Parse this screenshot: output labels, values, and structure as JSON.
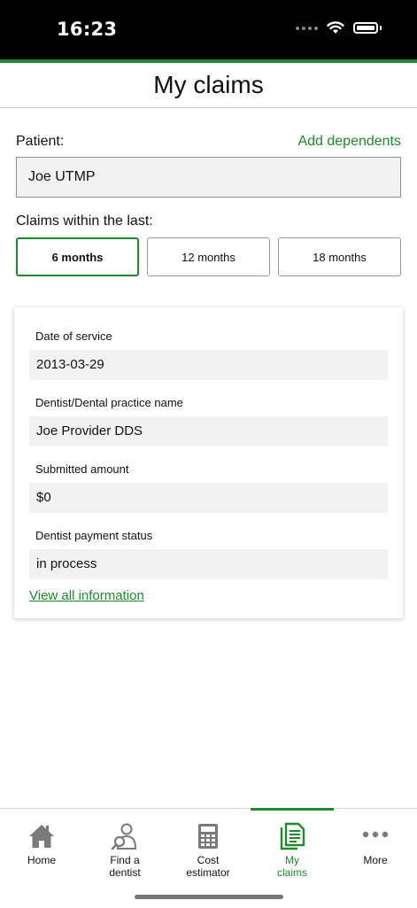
{
  "status_bar": {
    "time": "16:23"
  },
  "header": {
    "title": "My claims"
  },
  "patient": {
    "label": "Patient:",
    "add_dependents": "Add dependents",
    "value": "Joe UTMP"
  },
  "claims_range": {
    "label": "Claims within the last:",
    "options": [
      "6 months",
      "12 months",
      "18 months"
    ],
    "selected": "6 months"
  },
  "claim": {
    "fields": [
      {
        "label": "Date of service",
        "value": "2013-03-29"
      },
      {
        "label": "Dentist/Dental practice name",
        "value": "Joe Provider DDS"
      },
      {
        "label": "Submitted amount",
        "value": "$0"
      },
      {
        "label": "Dentist payment status",
        "value": "in process"
      }
    ],
    "view_all": "View all information"
  },
  "tabs": [
    {
      "label": "Home",
      "icon": "home-icon"
    },
    {
      "label": "Find a\ndentist",
      "label1": "Find a",
      "label2": "dentist",
      "icon": "find-dentist-icon"
    },
    {
      "label1": "Cost",
      "label2": "estimator",
      "icon": "calculator-icon"
    },
    {
      "label1": "My",
      "label2": "claims",
      "icon": "claims-document-icon"
    },
    {
      "label": "More",
      "icon": "more-dots-icon"
    }
  ],
  "colors": {
    "accent": "#1f8a2a",
    "status_bar": "#000000",
    "field_bg": "#f2f2f2"
  }
}
